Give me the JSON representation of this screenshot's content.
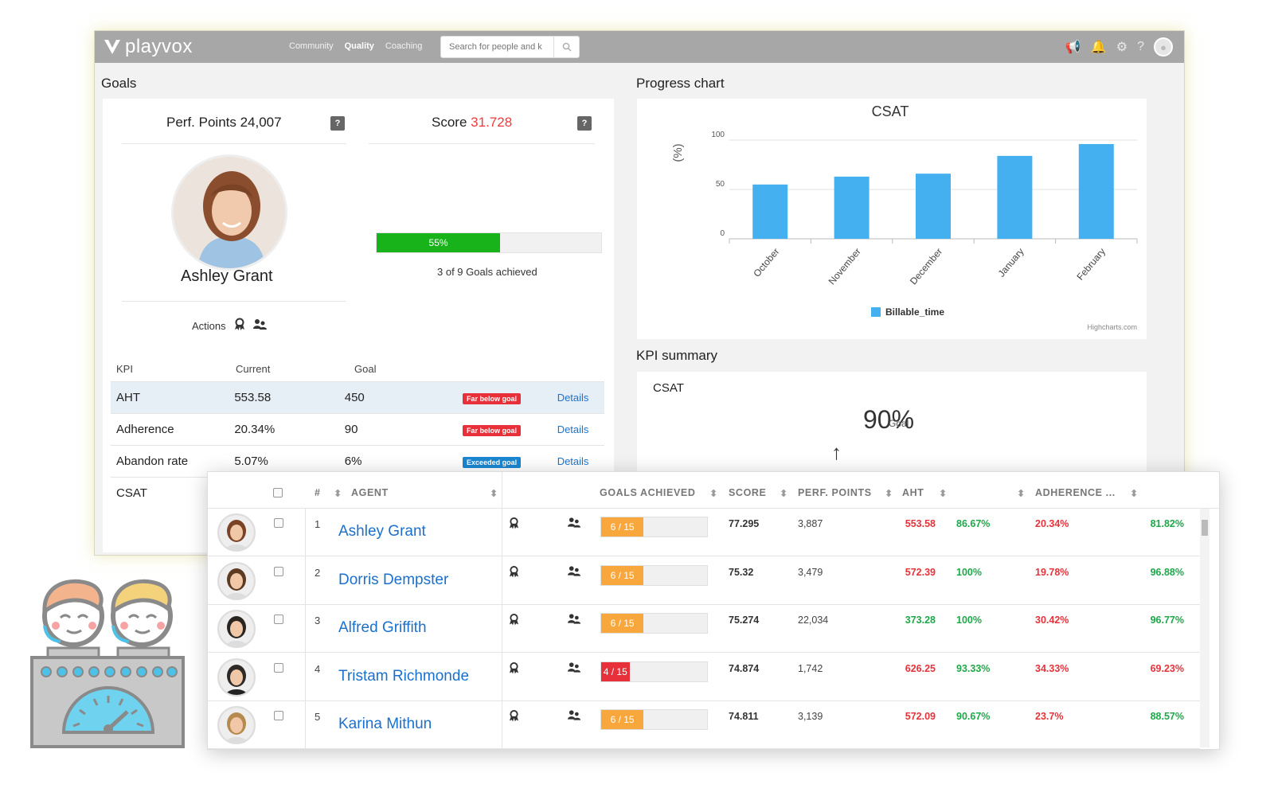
{
  "app": {
    "logo_text": "playvox",
    "nav": [
      "Community",
      "Quality",
      "Coaching"
    ],
    "active_nav": "Quality",
    "search_placeholder": "Search for people and k"
  },
  "goals": {
    "title": "Goals",
    "perf_points_label": "Perf. Points 24,007",
    "score_label": "Score",
    "score_value": "31.728",
    "help_label": "?",
    "agent_name": "Ashley Grant",
    "progress_percent": 55,
    "progress_text": "55%",
    "goals_achieved_text": "3 of 9 Goals achieved",
    "actions_label": "Actions"
  },
  "kpi_table": {
    "headers": [
      "KPI",
      "Current",
      "Goal"
    ],
    "rows": [
      {
        "kpi": "AHT",
        "current": "553.58",
        "goal": "450",
        "badge": "Far below goal",
        "badge_color": "#e8303a",
        "link": "Details"
      },
      {
        "kpi": "Adherence",
        "current": "20.34%",
        "goal": "90",
        "badge": "Far below goal",
        "badge_color": "#e8303a",
        "link": "Details"
      },
      {
        "kpi": "Abandon rate",
        "current": "5.07%",
        "goal": "6%",
        "badge": "Exceeded goal",
        "badge_color": "#1b86d0",
        "link": "Details"
      },
      {
        "kpi": "CSAT",
        "current": "",
        "goal": "",
        "badge": "",
        "badge_color": "",
        "link": ""
      }
    ]
  },
  "progress_chart": {
    "title": "Progress chart",
    "credits": "Highcharts.com"
  },
  "chart_data": {
    "type": "bar",
    "title": "CSAT",
    "ylabel": "(%)",
    "xlabel": "",
    "categories": [
      "October",
      "November",
      "December",
      "January",
      "February"
    ],
    "series": [
      {
        "name": "Billable_time",
        "values": [
          55,
          63,
          66,
          84,
          96
        ],
        "color": "#44b0f0"
      }
    ],
    "ylim": [
      0,
      100
    ],
    "yticks": [
      0,
      50,
      100
    ],
    "grid": true,
    "legend": "bottom-center"
  },
  "kpi_summary": {
    "title": "KPI summary",
    "label": "CSAT",
    "value": "90%",
    "goal_text": "Goal",
    "arrow": "↑"
  },
  "leaderboard": {
    "headers": {
      "num": "#",
      "agent": "AGENT",
      "goals": "GOALS ACHIEVED",
      "score": "SCORE",
      "perf": "PERF. POINTS",
      "aht": "AHT",
      "adherence": "ADHERENCE ..."
    },
    "sort_glyph": "⬍",
    "rows": [
      {
        "num": "1",
        "name": "Ashley Grant",
        "goals": "6 / 15",
        "goals_fraction": 0.4,
        "goals_color": "#f8a73c",
        "score": "77.295",
        "perf": "3,887",
        "aht": "553.58",
        "aht_color": "red",
        "p1": "86.67%",
        "p1_color": "green",
        "adh": "20.34%",
        "adh_color": "red",
        "p2": "81.82%",
        "p2_color": "green"
      },
      {
        "num": "2",
        "name": "Dorris Dempster",
        "goals": "6 / 15",
        "goals_fraction": 0.4,
        "goals_color": "#f8a73c",
        "score": "75.32",
        "perf": "3,479",
        "aht": "572.39",
        "aht_color": "red",
        "p1": "100%",
        "p1_color": "green",
        "adh": "19.78%",
        "adh_color": "red",
        "p2": "96.88%",
        "p2_color": "green"
      },
      {
        "num": "3",
        "name": "Alfred Griffith",
        "goals": "6 / 15",
        "goals_fraction": 0.4,
        "goals_color": "#f8a73c",
        "score": "75.274",
        "perf": "22,034",
        "aht": "373.28",
        "aht_color": "green",
        "p1": "100%",
        "p1_color": "green",
        "adh": "30.42%",
        "adh_color": "red",
        "p2": "96.77%",
        "p2_color": "green"
      },
      {
        "num": "4",
        "name": "Tristam Richmonde",
        "goals": "4 / 15",
        "goals_fraction": 0.267,
        "goals_color": "#e8303a",
        "score": "74.874",
        "perf": "1,742",
        "aht": "626.25",
        "aht_color": "red",
        "p1": "93.33%",
        "p1_color": "green",
        "adh": "34.33%",
        "adh_color": "red",
        "p2": "69.23%",
        "p2_color": "red"
      },
      {
        "num": "5",
        "name": "Karina Mithun",
        "goals": "6 / 15",
        "goals_fraction": 0.4,
        "goals_color": "#f8a73c",
        "score": "74.811",
        "perf": "3,139",
        "aht": "572.09",
        "aht_color": "red",
        "p1": "90.67%",
        "p1_color": "green",
        "adh": "23.7%",
        "adh_color": "red",
        "p2": "88.57%",
        "p2_color": "green"
      }
    ]
  }
}
